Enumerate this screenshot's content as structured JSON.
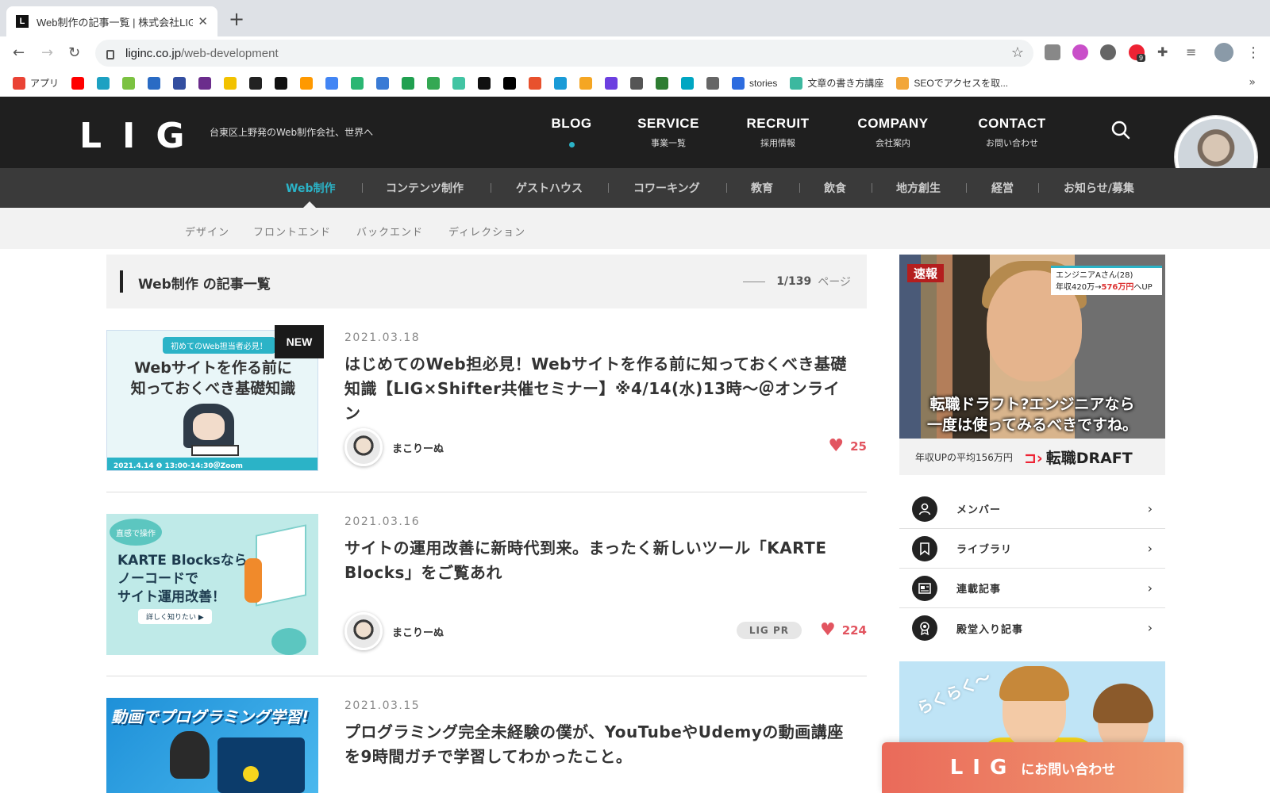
{
  "browser": {
    "tab_title": "Web制作の記事一覧 | 株式会社LIG",
    "tab_favicon": "L",
    "new_tab": "+",
    "url_host": "liginc.co.jp",
    "url_path": "/web-development",
    "extension_badge": "9",
    "bookmarks": [
      {
        "label": "アプリ",
        "color": "#ea4335"
      },
      {
        "label": "",
        "color": "#ff0000"
      },
      {
        "label": "",
        "color": "#1da1c2"
      },
      {
        "label": "",
        "color": "#7cc242"
      },
      {
        "label": "",
        "color": "#2a6bc4"
      },
      {
        "label": "",
        "color": "#334ea0"
      },
      {
        "label": "",
        "color": "#6b2d8c"
      },
      {
        "label": "",
        "color": "#f2c200"
      },
      {
        "label": "",
        "color": "#222222"
      },
      {
        "label": "",
        "color": "#111111"
      },
      {
        "label": "",
        "color": "#ff9900"
      },
      {
        "label": "",
        "color": "#4285f4"
      },
      {
        "label": "",
        "color": "#2bb673"
      },
      {
        "label": "",
        "color": "#3a7bd5"
      },
      {
        "label": "",
        "color": "#20a050"
      },
      {
        "label": "",
        "color": "#34a853"
      },
      {
        "label": "",
        "color": "#42c4a3"
      },
      {
        "label": "",
        "color": "#111111"
      },
      {
        "label": "",
        "color": "#000000"
      },
      {
        "label": "",
        "color": "#e8512d"
      },
      {
        "label": "",
        "color": "#1a9bd7"
      },
      {
        "label": "",
        "color": "#f5a623"
      },
      {
        "label": "",
        "color": "#6c3fe0"
      },
      {
        "label": "",
        "color": "#555555"
      },
      {
        "label": "",
        "color": "#2e7d32"
      },
      {
        "label": "",
        "color": "#00a6c2"
      },
      {
        "label": "",
        "color": "#666666"
      },
      {
        "label": "stories",
        "color": "#2d6cdf"
      },
      {
        "label": "文章の書き方講座",
        "color": "#3cb89f"
      },
      {
        "label": "SEOでアクセスを取...",
        "color": "#f2a63a"
      }
    ],
    "bookmarks_more": "»"
  },
  "header": {
    "logo": "LIG",
    "tagline": "台東区上野発のWeb制作会社、世界へ",
    "nav": [
      {
        "en": "BLOG",
        "ja": "",
        "active": true
      },
      {
        "en": "SERVICE",
        "ja": "事業一覧"
      },
      {
        "en": "RECRUIT",
        "ja": "採用情報"
      },
      {
        "en": "COMPANY",
        "ja": "会社案内"
      },
      {
        "en": "CONTACT",
        "ja": "お問い合わせ"
      }
    ]
  },
  "categories": [
    "Web制作",
    "コンテンツ制作",
    "ゲストハウス",
    "コワーキング",
    "教育",
    "飲食",
    "地方創生",
    "経営",
    "お知らせ/募集"
  ],
  "subcategories": [
    "デザイン",
    "フロントエンド",
    "バックエンド",
    "ディレクション"
  ],
  "list": {
    "title": "Web制作 の記事一覧",
    "page": "1/139",
    "page_suffix": "ページ"
  },
  "articles": [
    {
      "date": "2021.03.18",
      "title": "はじめてのWeb担必見！Webサイトを作る前に知っておくべき基礎知識【LIG×Shifter共催セミナー】※4/14(水)13時〜＠オンライン",
      "author": "まこりーぬ",
      "likes": "25",
      "new": "NEW",
      "thumb_badge": "初めてのWeb担当者必見！",
      "thumb_title1": "Webサイトを作る前に",
      "thumb_title2": "知っておくべき基礎知識",
      "thumb_date": "2021.4.14 ❶ 13:00-14:30＠Zoom"
    },
    {
      "date": "2021.03.16",
      "title": "サイトの運用改善に新時代到来。まったく新しいツール「KARTE Blocks」をご覧あれ",
      "author": "まこりーぬ",
      "likes": "224",
      "tag": "LIG PR",
      "thumb_bubble": "直感で操作",
      "thumb_title1": "KARTE Blocksなら",
      "thumb_title2": "ノーコードで",
      "thumb_title3": "サイト運用改善！",
      "thumb_btn": "詳しく知りたい ▶"
    },
    {
      "date": "2021.03.15",
      "title": "プログラミング完全未経験の僕が、YouTubeやUdemyの動画講座を9時間ガチで学習してわかったこと。",
      "thumb_title": "動画でプログラミング学習!"
    }
  ],
  "sidebar": {
    "ad1": {
      "badge": "速報",
      "info_line1": "エンジニアAさん(28)",
      "info_line2_a": "年収420万",
      "info_line2_b": "→",
      "info_line2_c": "576万円",
      "info_line2_d": "へUP",
      "caption1": "転職ドラフト?エンジニアなら",
      "caption2": "一度は使ってみるべきですね。",
      "footer": "年収UPの平均156万円",
      "brand": "転職DRAFT",
      "brand_mark": "⊐›"
    },
    "links": [
      {
        "label": "メンバー",
        "icon": "person-icon"
      },
      {
        "label": "ライブラリ",
        "icon": "bookmark-icon"
      },
      {
        "label": "連載記事",
        "icon": "newspaper-icon"
      },
      {
        "label": "殿堂入り記事",
        "icon": "award-icon"
      }
    ],
    "ad2_text": "らくらく〜"
  },
  "contact_float": {
    "logo": "LIG",
    "label": "にお問い合わせ"
  },
  "colors": {
    "accent": "#2bb3c7",
    "header_bg": "#1f1f1f",
    "like": "#e25560",
    "contact": "#ea6a5a"
  }
}
